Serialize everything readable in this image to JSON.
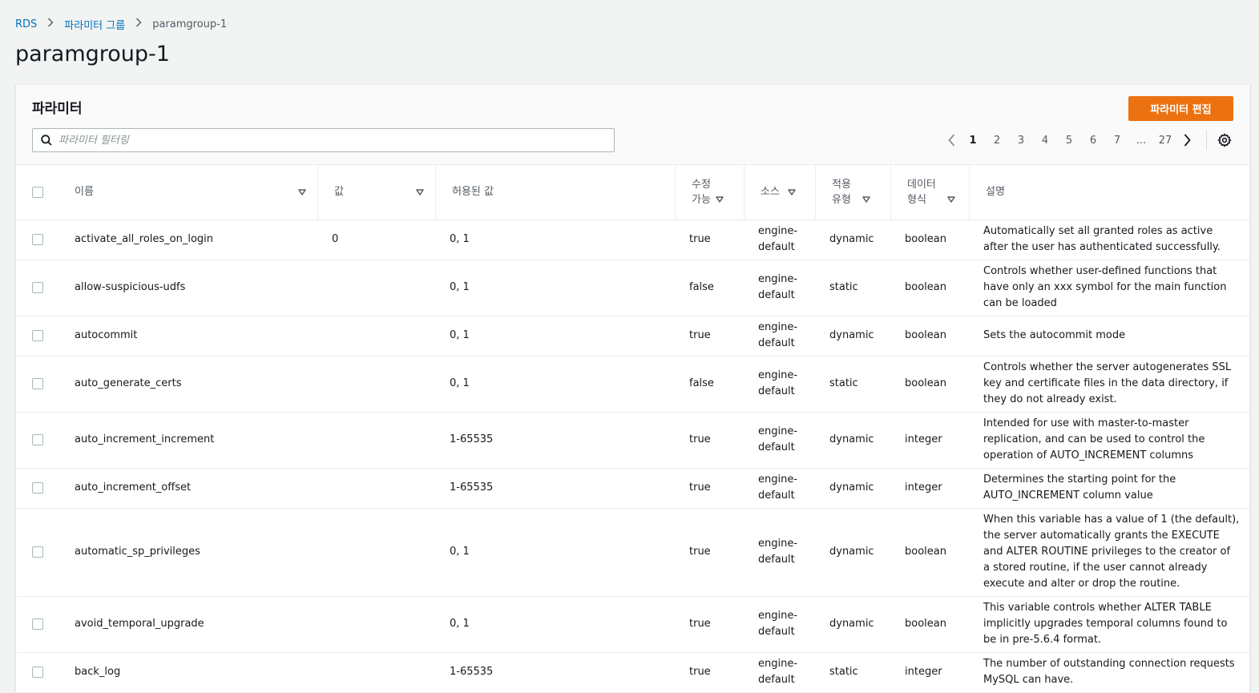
{
  "breadcrumb": {
    "root": "RDS",
    "parent": "파라미터 그룹",
    "current": "paramgroup-1"
  },
  "page_title": "paramgroup-1",
  "panel": {
    "title": "파라미터",
    "edit_button": "파라미터 편집",
    "search_placeholder": "파라미터 필터링"
  },
  "pagination": {
    "pages": [
      "1",
      "2",
      "3",
      "4",
      "5",
      "6",
      "7"
    ],
    "ellipsis": "...",
    "last": "27",
    "current": "1"
  },
  "columns": {
    "name": "이름",
    "value": "값",
    "allowed": "허용된 값",
    "modifiable_1": "수정",
    "modifiable_2": "가능",
    "source": "소스",
    "apply_1": "적용",
    "apply_2": "유형",
    "datatype_1": "데이터",
    "datatype_2": "형식",
    "description": "설명"
  },
  "rows": [
    {
      "name": "activate_all_roles_on_login",
      "value": "0",
      "allowed": "0, 1",
      "modifiable": "true",
      "source": "engine-default",
      "apply": "dynamic",
      "type": "boolean",
      "desc": "Automatically set all granted roles as active after the user has authenticated successfully."
    },
    {
      "name": "allow-suspicious-udfs",
      "value": "",
      "allowed": "0, 1",
      "modifiable": "false",
      "source": "engine-default",
      "apply": "static",
      "type": "boolean",
      "desc": "Controls whether user-defined functions that have only an xxx symbol for the main function can be loaded"
    },
    {
      "name": "autocommit",
      "value": "",
      "allowed": "0, 1",
      "modifiable": "true",
      "source": "engine-default",
      "apply": "dynamic",
      "type": "boolean",
      "desc": "Sets the autocommit mode"
    },
    {
      "name": "auto_generate_certs",
      "value": "",
      "allowed": "0, 1",
      "modifiable": "false",
      "source": "engine-default",
      "apply": "static",
      "type": "boolean",
      "desc": "Controls whether the server autogenerates SSL key and certificate files in the data directory, if they do not already exist."
    },
    {
      "name": "auto_increment_increment",
      "value": "",
      "allowed": "1-65535",
      "modifiable": "true",
      "source": "engine-default",
      "apply": "dynamic",
      "type": "integer",
      "desc": "Intended for use with master-to-master replication, and can be used to control the operation of AUTO_INCREMENT columns"
    },
    {
      "name": "auto_increment_offset",
      "value": "",
      "allowed": "1-65535",
      "modifiable": "true",
      "source": "engine-default",
      "apply": "dynamic",
      "type": "integer",
      "desc": "Determines the starting point for the AUTO_INCREMENT column value"
    },
    {
      "name": "automatic_sp_privileges",
      "value": "",
      "allowed": "0, 1",
      "modifiable": "true",
      "source": "engine-default",
      "apply": "dynamic",
      "type": "boolean",
      "desc": "When this variable has a value of 1 (the default), the server automatically grants the EXECUTE and ALTER ROUTINE privileges to the creator of a stored routine, if the user cannot already execute and alter or drop the routine."
    },
    {
      "name": "avoid_temporal_upgrade",
      "value": "",
      "allowed": "0, 1",
      "modifiable": "true",
      "source": "engine-default",
      "apply": "dynamic",
      "type": "boolean",
      "desc": "This variable controls whether ALTER TABLE implicitly upgrades temporal columns found to be in pre-5.6.4 format."
    },
    {
      "name": "back_log",
      "value": "",
      "allowed": "1-65535",
      "modifiable": "true",
      "source": "engine-default",
      "apply": "static",
      "type": "integer",
      "desc": "The number of outstanding connection requests MySQL can have."
    }
  ]
}
